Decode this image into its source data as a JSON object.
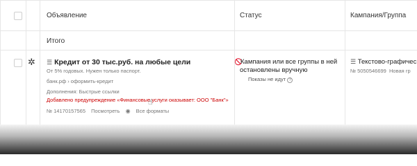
{
  "header": {
    "ad": "Объявление",
    "status": "Статус",
    "campaign": "Кампания/Группа"
  },
  "total": {
    "label": "Итого"
  },
  "ad": {
    "title": "Кредит от 30 тыс.руб. на любые цели",
    "subtitle": "От 5% годовых. Нужен только паспорт.",
    "url": "банк.рф › оформить-кредит",
    "extras": "Дополнения: Быстрые ссылки",
    "warning": "Добавлено предупреждение «Финансовые услуги оказывает: ООО \"Банк\"»",
    "id": "№ 14170157565",
    "view_link": "Посмотреть",
    "formats_link": "Все форматы"
  },
  "status": {
    "text": "Кампания или все группы в ней остановлены вручную",
    "sub": "Показы не идут",
    "color": "#e0001b"
  },
  "campaign": {
    "name": "Текстово-графичес",
    "id": "№ 5050546699",
    "group": "Новая гр"
  },
  "icons": {
    "gear": "gear-icon",
    "stop": "stop-icon",
    "document": "document-icon",
    "help": "help-icon",
    "eye": "eye-icon",
    "cursor": "hand-cursor-icon"
  }
}
